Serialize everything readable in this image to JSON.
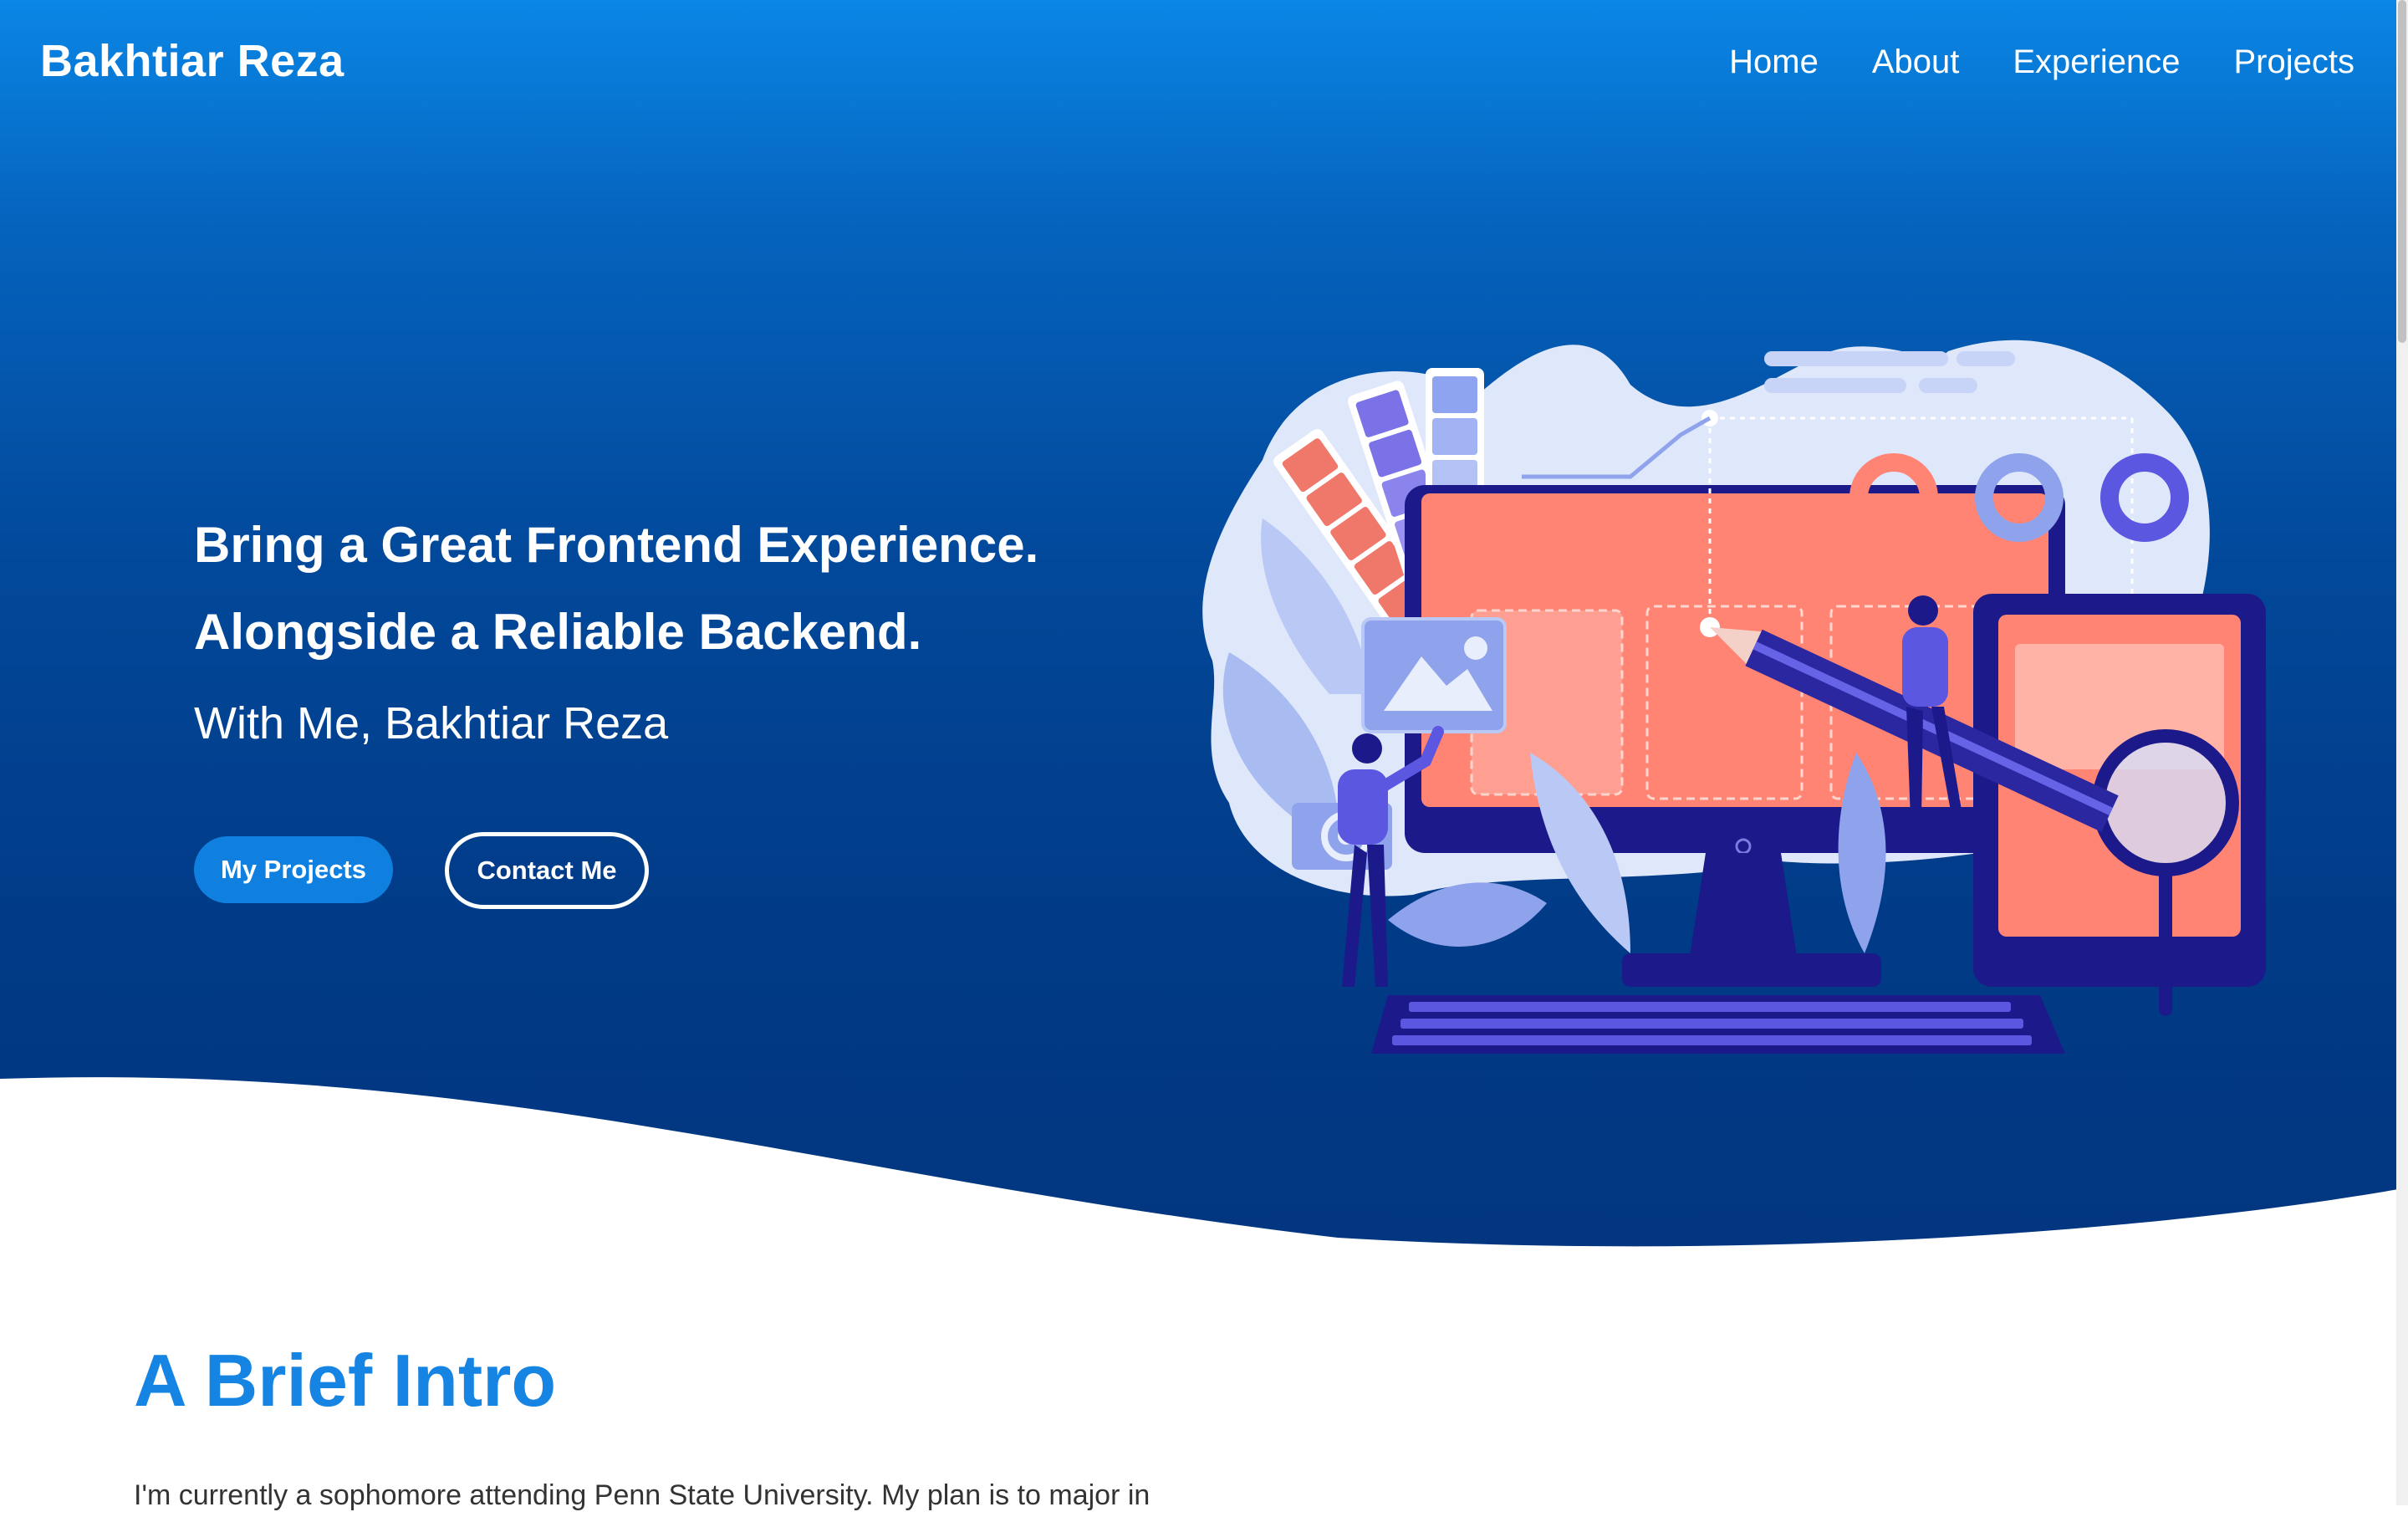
{
  "brand": "Bakhtiar Reza",
  "nav": {
    "home": "Home",
    "about": "About",
    "experience": "Experience",
    "projects": "Projects"
  },
  "hero": {
    "line1": "Bring a Great Frontend Experience.",
    "line2": "Alongside a Reliable Backend.",
    "subtitle": "With Me, Bakhtiar Reza",
    "primary_button": "My Projects",
    "secondary_button": "Contact Me",
    "illustration": "web-design-illustration"
  },
  "intro": {
    "title": "A Brief Intro",
    "text": "I'm currently a sophomore attending Penn State University. My plan is to major in"
  },
  "colors": {
    "hero_top": "#0a86e6",
    "hero_bottom": "#023680",
    "accent": "#1584e3",
    "button": "#0f7fe0"
  }
}
